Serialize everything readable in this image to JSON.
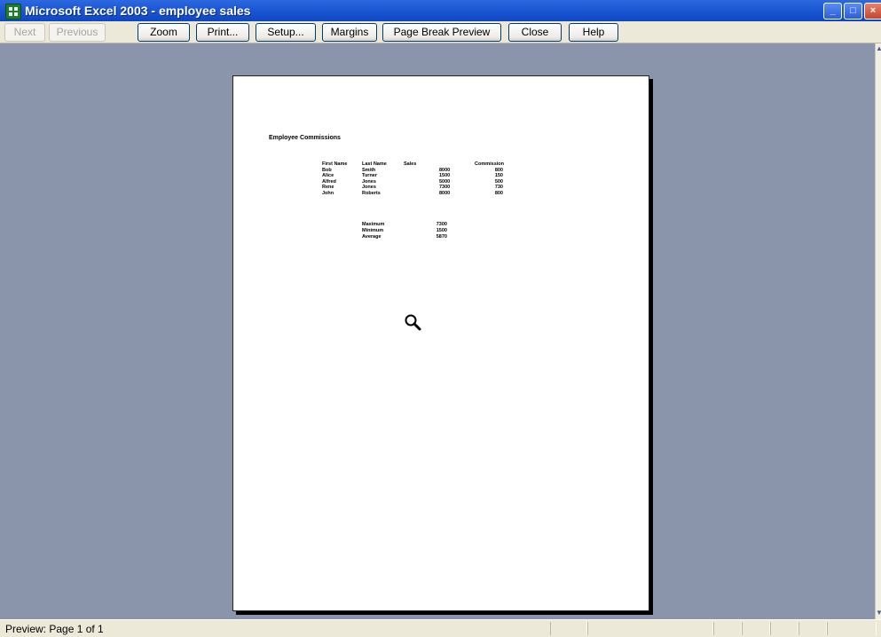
{
  "window": {
    "title": "Microsoft Excel 2003 - employee sales",
    "controls": {
      "minimize": "_",
      "maximize": "□",
      "close": "×"
    }
  },
  "toolbar": {
    "buttons": [
      {
        "label": "Next",
        "enabled": false
      },
      {
        "label": "Previous",
        "enabled": false
      },
      {
        "label": "Zoom",
        "enabled": true
      },
      {
        "label": "Print...",
        "enabled": true
      },
      {
        "label": "Setup...",
        "enabled": true
      },
      {
        "label": "Margins",
        "enabled": true
      },
      {
        "label": "Page Break Preview",
        "enabled": true
      },
      {
        "label": "Close",
        "enabled": true
      },
      {
        "label": "Help",
        "enabled": true
      }
    ]
  },
  "page": {
    "title": "Employee Commissions",
    "headers": [
      "First Name",
      "Last Name",
      "Sales",
      "Commission"
    ],
    "rows": [
      [
        "Bob",
        "Smith",
        "8000",
        "800"
      ],
      [
        "Alice",
        "Turner",
        "1500",
        "150"
      ],
      [
        "Alfred",
        "Jones",
        "5000",
        "500"
      ],
      [
        "Rene",
        "Jones",
        "7300",
        "730"
      ],
      [
        "John",
        "Roberts",
        "8000",
        "800"
      ]
    ],
    "summary": [
      [
        "Maximum",
        "7300"
      ],
      [
        "Minimum",
        "1500"
      ],
      [
        "Average",
        "5870"
      ]
    ]
  },
  "status": {
    "text": "Preview: Page 1 of 1"
  },
  "icons": {
    "cursor": "magnifier-zoom-icon",
    "app": "excel-icon"
  },
  "colors": {
    "background": "#8a94ab",
    "titlebar": "#1d58d6",
    "toolbar": "#ece9d8"
  }
}
